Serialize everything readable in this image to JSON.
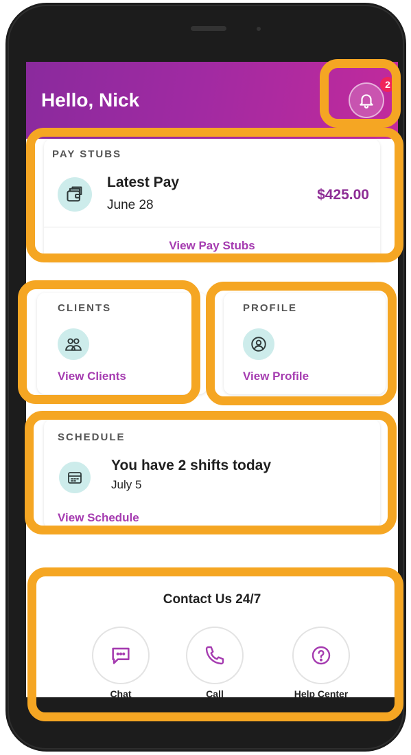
{
  "header": {
    "greeting": "Hello, Nick",
    "notification_count": "2",
    "bell_icon": "bell-icon"
  },
  "pay_stubs": {
    "section_title": "PAY STUBS",
    "latest_label": "Latest Pay",
    "date": "June 28",
    "amount": "$425.00",
    "link": "View Pay Stubs",
    "icon": "wallet-icon"
  },
  "clients": {
    "section_title": "CLIENTS",
    "link": "View Clients",
    "icon": "people-icon"
  },
  "profile": {
    "section_title": "PROFILE",
    "link": "View Profile",
    "icon": "user-icon"
  },
  "schedule": {
    "section_title": "SCHEDULE",
    "title": "You have 2 shifts today",
    "date": "July 5",
    "link": "View Schedule",
    "icon": "calendar-icon"
  },
  "contact": {
    "title": "Contact Us 24/7",
    "buttons": [
      {
        "label": "Chat",
        "icon": "chat-icon"
      },
      {
        "label": "Call",
        "icon": "phone-icon"
      },
      {
        "label": "Help Center",
        "icon": "question-icon"
      }
    ]
  },
  "colors": {
    "header_start": "#8a2a9d",
    "header_end": "#c22a9c",
    "accent": "#a53bb0",
    "icon_bg": "#cdeceb",
    "highlight": "#f5a623",
    "badge": "#f0245a"
  }
}
